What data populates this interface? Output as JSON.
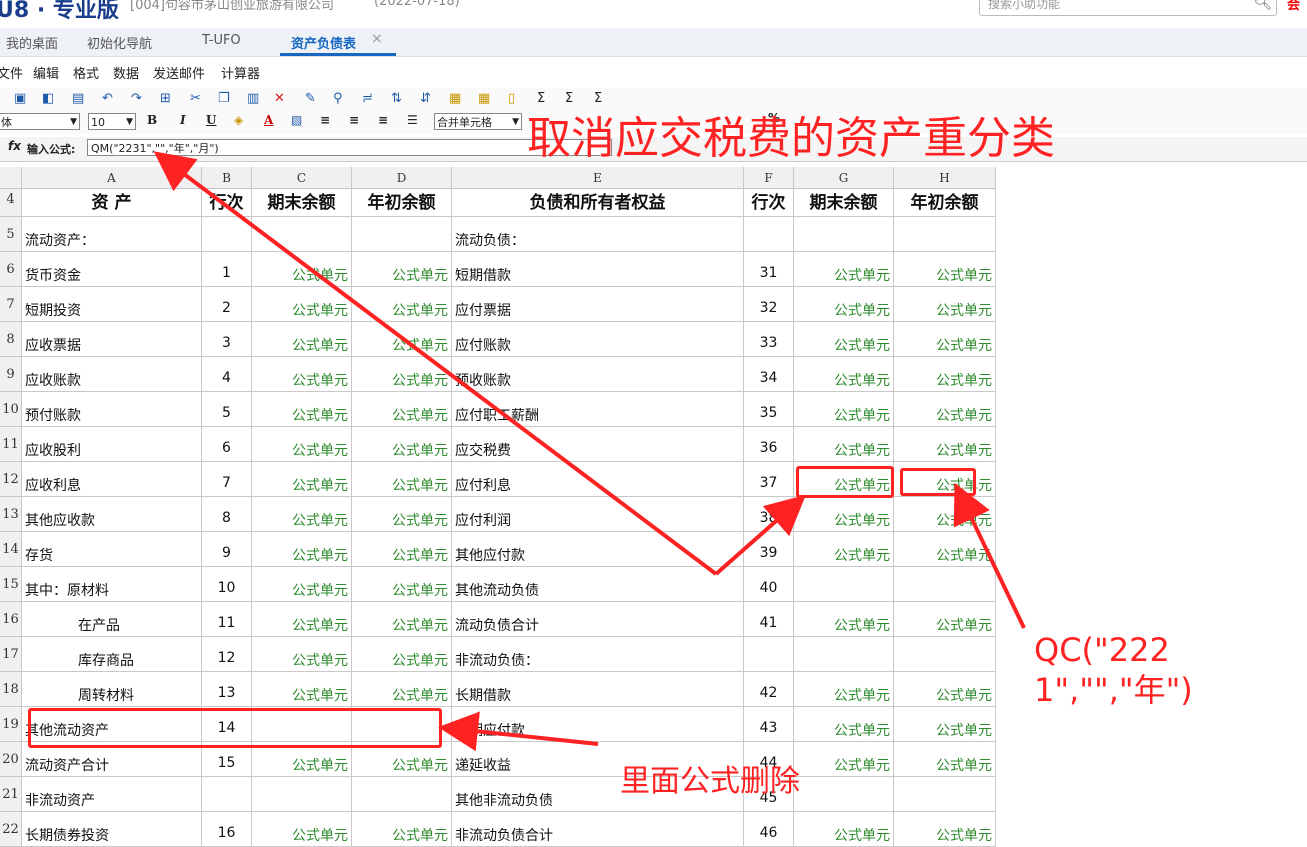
{
  "title_bar": {
    "product": "U8 · 专业版",
    "company": "[004]句容市茅山创业旅游有限公司",
    "date": "(2022-07-18)",
    "search_placeholder": "搜索小助功能",
    "badge": "会"
  },
  "tabs": [
    {
      "label": "我的桌面"
    },
    {
      "label": "初始化导航"
    },
    {
      "label": "T-UFO"
    },
    {
      "label": "资产负债表",
      "active": true
    }
  ],
  "tab_close": "×",
  "menu": [
    "文件",
    "编辑",
    "格式",
    "数据",
    "发送邮件",
    "计算器"
  ],
  "format_bar": {
    "font": "体",
    "size": "10",
    "bold": "B",
    "italic": "I",
    "underline": "U",
    "merge": "合并单元格",
    "percent": "%"
  },
  "formula_bar": {
    "label": "输入公式:",
    "value": "QM(\"2231\",\"\",\"年\",\"月\")"
  },
  "columns": [
    "A",
    "B",
    "C",
    "D",
    "E",
    "F",
    "G",
    "H"
  ],
  "header_row": {
    "num": "4",
    "cells": [
      "资 产",
      "行次",
      "期末余额",
      "年初余额",
      "负债和所有者权益",
      "行次",
      "期末余额",
      "年初余额"
    ]
  },
  "formula_text": "公式单元",
  "rows": [
    {
      "num": "5",
      "a": "流动资产：",
      "b": "",
      "c": "",
      "d": "",
      "e": "流动负债：",
      "f": "",
      "g": "",
      "h": ""
    },
    {
      "num": "6",
      "a": "货币资金",
      "b": "1",
      "c": "公式单元",
      "d": "公式单元",
      "e": "短期借款",
      "f": "31",
      "g": "公式单元",
      "h": "公式单元"
    },
    {
      "num": "7",
      "a": "短期投资",
      "b": "2",
      "c": "公式单元",
      "d": "公式单元",
      "e": "应付票据",
      "f": "32",
      "g": "公式单元",
      "h": "公式单元"
    },
    {
      "num": "8",
      "a": "应收票据",
      "b": "3",
      "c": "公式单元",
      "d": "公式单元",
      "e": "应付账款",
      "f": "33",
      "g": "公式单元",
      "h": "公式单元"
    },
    {
      "num": "9",
      "a": "应收账款",
      "b": "4",
      "c": "公式单元",
      "d": "公式单元",
      "e": "预收账款",
      "f": "34",
      "g": "公式单元",
      "h": "公式单元"
    },
    {
      "num": "10",
      "a": "预付账款",
      "b": "5",
      "c": "公式单元",
      "d": "公式单元",
      "e": "应付职工薪酬",
      "f": "35",
      "g": "公式单元",
      "h": "公式单元"
    },
    {
      "num": "11",
      "a": "应收股利",
      "b": "6",
      "c": "公式单元",
      "d": "公式单元",
      "e": "应交税费",
      "f": "36",
      "g": "公式单元",
      "h": "公式单元"
    },
    {
      "num": "12",
      "a": "应收利息",
      "b": "7",
      "c": "公式单元",
      "d": "公式单元",
      "e": "应付利息",
      "f": "37",
      "g": "公式单元",
      "h": "公式单元"
    },
    {
      "num": "13",
      "a": "其他应收款",
      "b": "8",
      "c": "公式单元",
      "d": "公式单元",
      "e": "应付利润",
      "f": "38",
      "g": "公式单元",
      "h": "公式单元"
    },
    {
      "num": "14",
      "a": "存货",
      "b": "9",
      "c": "公式单元",
      "d": "公式单元",
      "e": "其他应付款",
      "f": "39",
      "g": "公式单元",
      "h": "公式单元"
    },
    {
      "num": "15",
      "a": "其中：原材料",
      "b": "10",
      "c": "公式单元",
      "d": "公式单元",
      "e": "其他流动负债",
      "f": "40",
      "g": "",
      "h": ""
    },
    {
      "num": "16",
      "a": "在产品",
      "indent": true,
      "b": "11",
      "c": "公式单元",
      "d": "公式单元",
      "e": "流动负债合计",
      "f": "41",
      "g": "公式单元",
      "h": "公式单元"
    },
    {
      "num": "17",
      "a": "库存商品",
      "indent": true,
      "b": "12",
      "c": "公式单元",
      "d": "公式单元",
      "e": "非流动负债：",
      "f": "",
      "g": "",
      "h": ""
    },
    {
      "num": "18",
      "a": "周转材料",
      "indent": true,
      "b": "13",
      "c": "公式单元",
      "d": "公式单元",
      "e": "长期借款",
      "f": "42",
      "g": "公式单元",
      "h": "公式单元"
    },
    {
      "num": "19",
      "a": "其他流动资产",
      "b": "14",
      "c": "",
      "d": "",
      "e": "长期应付款",
      "f": "43",
      "g": "公式单元",
      "h": "公式单元"
    },
    {
      "num": "20",
      "a": "流动资产合计",
      "b": "15",
      "c": "公式单元",
      "d": "公式单元",
      "e": "递延收益",
      "f": "44",
      "g": "公式单元",
      "h": "公式单元"
    },
    {
      "num": "21",
      "a": "非流动资产",
      "b": "",
      "c": "",
      "d": "",
      "e": "其他非流动负债",
      "f": "45",
      "g": "",
      "h": ""
    },
    {
      "num": "22",
      "a": "长期债券投资",
      "b": "16",
      "c": "公式单元",
      "d": "公式单元",
      "e": "非流动负债合计",
      "f": "46",
      "g": "公式单元",
      "h": "公式单元"
    }
  ],
  "annotations": {
    "title": "取消应交税费的资产重分类",
    "qc_formula": "QC(\"2221\",\"\",\"年\")",
    "delete_note": "里面公式删除"
  },
  "colors": {
    "formula_green": "#2e8b2e",
    "annotation_red": "#ff2222",
    "tab_blue": "#1766c2"
  }
}
